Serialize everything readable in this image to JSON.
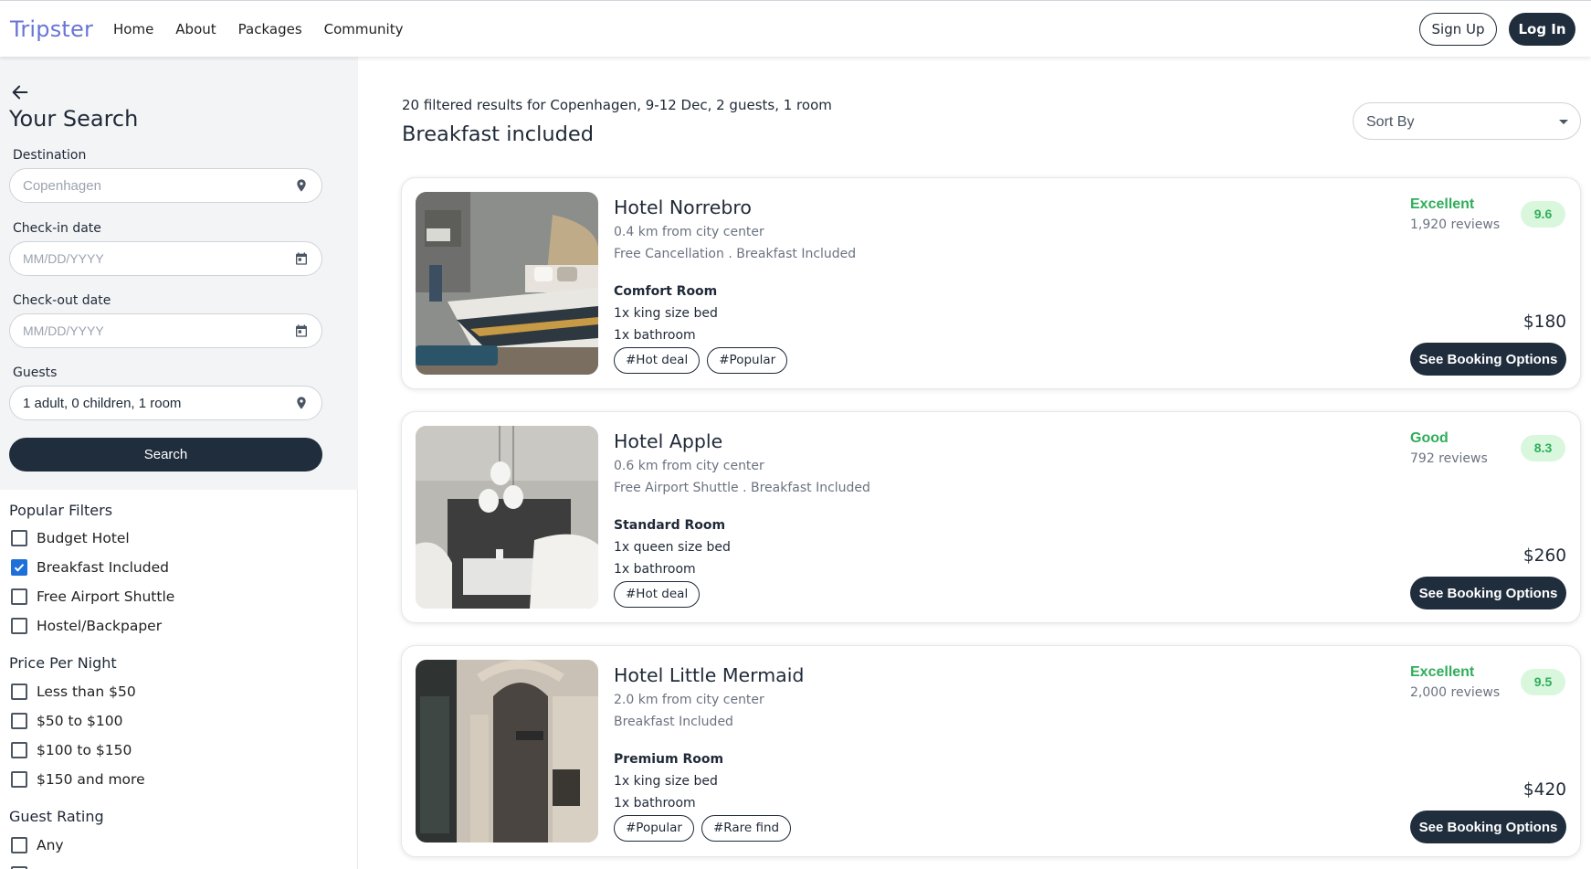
{
  "header": {
    "logo": "Tripster",
    "nav": [
      "Home",
      "About",
      "Packages",
      "Community"
    ],
    "signup": "Sign Up",
    "login": "Log In"
  },
  "search": {
    "title": "Your Search",
    "destination_label": "Destination",
    "destination_placeholder": "Copenhagen",
    "checkin_label": "Check-in date",
    "checkin_placeholder": "MM/DD/YYYY",
    "checkout_label": "Check-out date",
    "checkout_placeholder": "MM/DD/YYYY",
    "guests_label": "Guests",
    "guests_value": "1 adult, 0 children, 1 room",
    "search_button": "Search"
  },
  "filters": {
    "popular_title": "Popular Filters",
    "popular": [
      {
        "label": "Budget Hotel",
        "checked": false
      },
      {
        "label": "Breakfast Included",
        "checked": true
      },
      {
        "label": "Free Airport Shuttle",
        "checked": false
      },
      {
        "label": "Hostel/Backpaper",
        "checked": false
      }
    ],
    "price_title": "Price Per Night",
    "price": [
      {
        "label": "Less than $50",
        "checked": false
      },
      {
        "label": "$50 to $100",
        "checked": false
      },
      {
        "label": "$100 to $150",
        "checked": false
      },
      {
        "label": "$150 and more",
        "checked": false
      }
    ],
    "rating_title": "Guest Rating",
    "rating": [
      {
        "label": "Any",
        "checked": false
      }
    ]
  },
  "results": {
    "summary": "20 filtered results for Copenhagen, 9-12 Dec, 2 guests, 1 room",
    "title": "Breakfast included",
    "sort_label": "Sort By"
  },
  "hotels": [
    {
      "name": "Hotel Norrebro",
      "distance": "0.4 km from city center",
      "amenities": "Free Cancellation .  Breakfast Included",
      "room": "Comfort Room",
      "bed": "1x king size bed",
      "bath": "1x bathroom",
      "tags": [
        "#Hot deal",
        "#Popular"
      ],
      "rating_word": "Excellent",
      "reviews": "1,920 reviews",
      "score": "9.6",
      "price": "$180",
      "button": "See Booking Options"
    },
    {
      "name": "Hotel Apple",
      "distance": "0.6 km from city center",
      "amenities": "Free Airport Shuttle .  Breakfast Included",
      "room": "Standard Room",
      "bed": "1x queen size bed",
      "bath": "1x bathroom",
      "tags": [
        "#Hot deal"
      ],
      "rating_word": "Good",
      "reviews": "792 reviews",
      "score": "8.3",
      "price": "$260",
      "button": "See Booking Options"
    },
    {
      "name": "Hotel Little Mermaid",
      "distance": "2.0 km from city center",
      "amenities": "Breakfast Included",
      "room": "Premium Room",
      "bed": "1x king size bed",
      "bath": "1x bathroom",
      "tags": [
        "#Popular",
        "#Rare find"
      ],
      "rating_word": "Excellent",
      "reviews": "2,000 reviews",
      "score": "9.5",
      "price": "$420",
      "button": "See Booking Options"
    }
  ],
  "colors": {
    "brand": "#6875d6",
    "primary_dark": "#1f2d3d",
    "rating_green": "#2fae5a",
    "score_bg": "#d9f7dd",
    "checkbox_blue": "#1e6fd9"
  }
}
